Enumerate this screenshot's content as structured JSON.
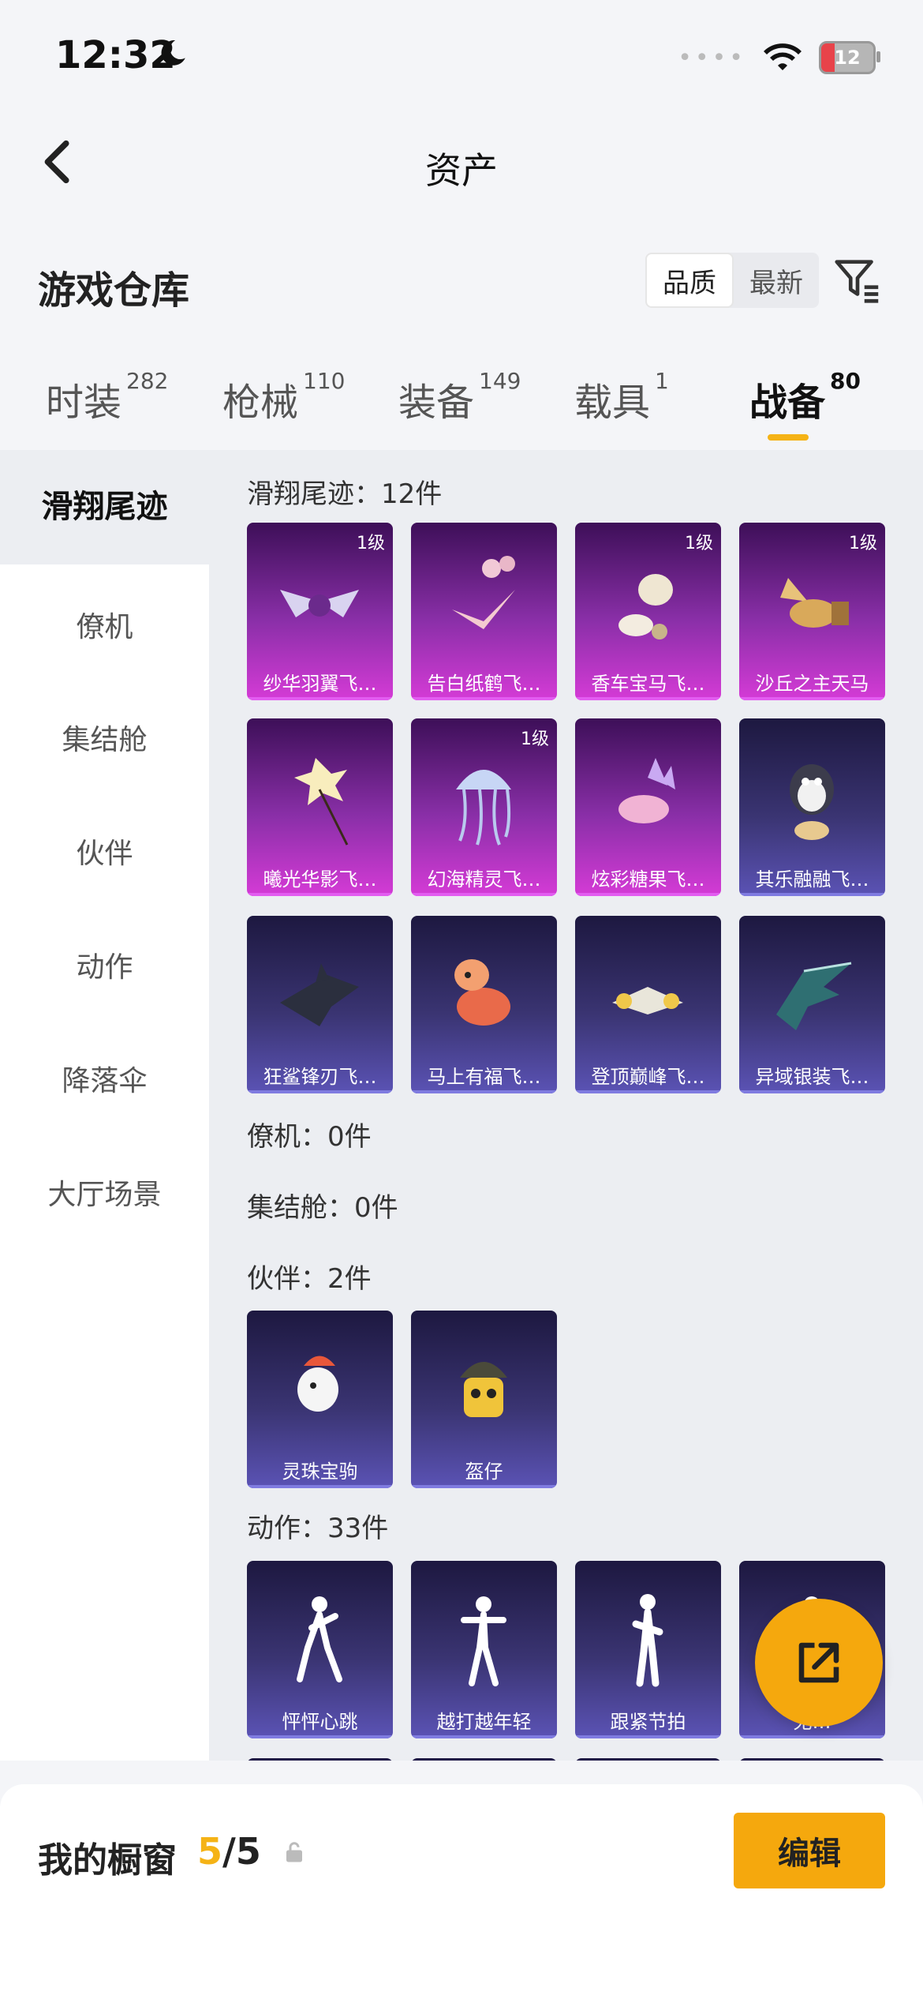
{
  "status_bar": {
    "time": "12:32",
    "battery": "12"
  },
  "nav": {
    "title": "资产"
  },
  "header": {
    "title": "游戏仓库",
    "sort_options": [
      "品质",
      "最新"
    ]
  },
  "tabs": [
    {
      "label": "时装",
      "count": "282"
    },
    {
      "label": "枪械",
      "count": "110"
    },
    {
      "label": "装备",
      "count": "149"
    },
    {
      "label": "载具",
      "count": "1"
    },
    {
      "label": "战备",
      "count": "80"
    }
  ],
  "sidebar": {
    "items": [
      "滑翔尾迹",
      "僚机",
      "集结舱",
      "伙伴",
      "动作",
      "降落伞",
      "大厅场景"
    ]
  },
  "sections": {
    "glide": {
      "title": "滑翔尾迹：12件",
      "items": [
        {
          "name": "纱华羽翼飞…",
          "level": "1级"
        },
        {
          "name": "告白纸鹤飞…",
          "level": ""
        },
        {
          "name": "香车宝马飞…",
          "level": "1级"
        },
        {
          "name": "沙丘之主天马",
          "level": "1级"
        },
        {
          "name": "曦光华影飞…",
          "level": ""
        },
        {
          "name": "幻海精灵飞…",
          "level": "1级"
        },
        {
          "name": "炫彩糖果飞…",
          "level": ""
        },
        {
          "name": "其乐融融飞…",
          "level": ""
        },
        {
          "name": "狂鲨锋刃飞…",
          "level": ""
        },
        {
          "name": "马上有福飞…",
          "level": ""
        },
        {
          "name": "登顶巅峰飞…",
          "level": ""
        },
        {
          "name": "异域银装飞…",
          "level": ""
        }
      ]
    },
    "wingman": {
      "title": "僚机：0件"
    },
    "pod": {
      "title": "集结舱：0件"
    },
    "partner": {
      "title": "伙伴：2件",
      "items": [
        {
          "name": "灵珠宝驹"
        },
        {
          "name": "盔仔"
        }
      ]
    },
    "emote": {
      "title": "动作：33件",
      "items": [
        {
          "name": "怦怦心跳"
        },
        {
          "name": "越打越年轻"
        },
        {
          "name": "跟紧节拍"
        },
        {
          "name": "无…"
        }
      ]
    }
  },
  "bottom": {
    "showcase_label": "我的橱窗",
    "showcase_current": "5",
    "showcase_total": "/5",
    "edit_label": "编辑"
  },
  "colors": {
    "accent": "#f5a80d",
    "purple_card": "#8a2fa8",
    "blue_card": "#3a3472"
  }
}
